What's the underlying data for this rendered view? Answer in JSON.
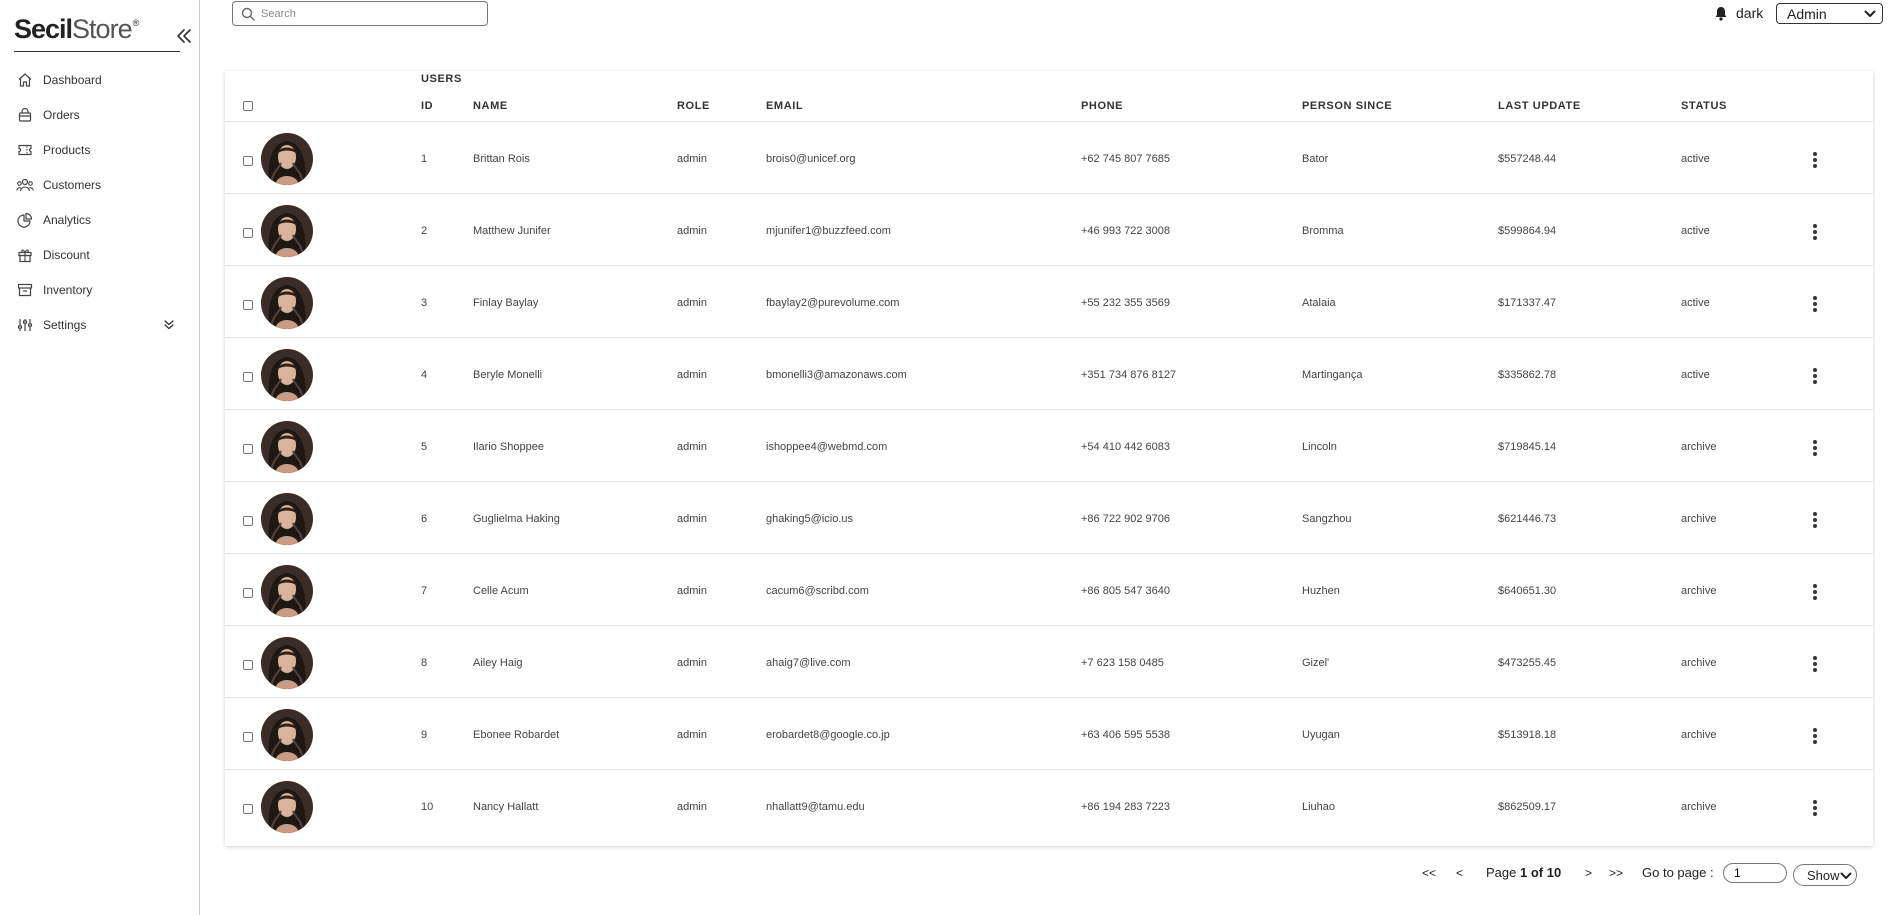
{
  "brand": {
    "name_bold": "Secil",
    "name_light": "Store",
    "mark": "®"
  },
  "sidebar": {
    "items": [
      {
        "label": "Dashboard",
        "icon": "home-icon"
      },
      {
        "label": "Orders",
        "icon": "shopping-bag-icon"
      },
      {
        "label": "Products",
        "icon": "ticket-icon"
      },
      {
        "label": "Customers",
        "icon": "users-icon"
      },
      {
        "label": "Analytics",
        "icon": "pie-chart-icon"
      },
      {
        "label": "Discount",
        "icon": "gift-icon"
      },
      {
        "label": "Inventory",
        "icon": "archive-icon"
      },
      {
        "label": "Settings",
        "icon": "sliders-icon"
      }
    ]
  },
  "search": {
    "placeholder": "Search"
  },
  "header": {
    "theme_label": "dark",
    "role_selected": "Admin"
  },
  "table": {
    "title": "USERS",
    "columns": {
      "id": "ID",
      "name": "NAME",
      "role": "ROLE",
      "email": "EMAIL",
      "phone": "PHONE",
      "person_since": "PERSON SINCE",
      "last_update": "LAST UPDATE",
      "status": "STATUS"
    },
    "rows": [
      {
        "id": "1",
        "name": "Brittan Rois",
        "role": "admin",
        "email": "brois0@unicef.org",
        "phone": "+62 745 807 7685",
        "person_since": "Bator",
        "last_update": "$557248.44",
        "status": "active"
      },
      {
        "id": "2",
        "name": "Matthew Junifer",
        "role": "admin",
        "email": "mjunifer1@buzzfeed.com",
        "phone": "+46 993 722 3008",
        "person_since": "Bromma",
        "last_update": "$599864.94",
        "status": "active"
      },
      {
        "id": "3",
        "name": "Finlay Baylay",
        "role": "admin",
        "email": "fbaylay2@purevolume.com",
        "phone": "+55 232 355 3569",
        "person_since": "Atalaia",
        "last_update": "$171337.47",
        "status": "active"
      },
      {
        "id": "4",
        "name": "Beryle Monelli",
        "role": "admin",
        "email": "bmonelli3@amazonaws.com",
        "phone": "+351 734 876 8127",
        "person_since": "Martingança",
        "last_update": "$335862.78",
        "status": "active"
      },
      {
        "id": "5",
        "name": "Ilario Shoppee",
        "role": "admin",
        "email": "ishoppee4@webmd.com",
        "phone": "+54 410 442 6083",
        "person_since": "Lincoln",
        "last_update": "$719845.14",
        "status": "archive"
      },
      {
        "id": "6",
        "name": "Guglielma Haking",
        "role": "admin",
        "email": "ghaking5@icio.us",
        "phone": "+86 722 902 9706",
        "person_since": "Sangzhou",
        "last_update": "$621446.73",
        "status": "archive"
      },
      {
        "id": "7",
        "name": "Celle Acum",
        "role": "admin",
        "email": "cacum6@scribd.com",
        "phone": "+86 805 547 3640",
        "person_since": "Huzhen",
        "last_update": "$640651.30",
        "status": "archive"
      },
      {
        "id": "8",
        "name": "Ailey Haig",
        "role": "admin",
        "email": "ahaig7@live.com",
        "phone": "+7 623 158 0485",
        "person_since": "Gizel'",
        "last_update": "$473255.45",
        "status": "archive"
      },
      {
        "id": "9",
        "name": "Ebonee Robardet",
        "role": "admin",
        "email": "erobardet8@google.co.jp",
        "phone": "+63 406 595 5538",
        "person_since": "Uyugan",
        "last_update": "$513918.18",
        "status": "archive"
      },
      {
        "id": "10",
        "name": "Nancy Hallatt",
        "role": "admin",
        "email": "nhallatt9@tamu.edu",
        "phone": "+86 194 283 7223",
        "person_since": "Liuhao",
        "last_update": "$862509.17",
        "status": "archive"
      }
    ]
  },
  "pagination": {
    "first": "<<",
    "prev": "<",
    "next": ">",
    "last": ">>",
    "page_prefix": "Page",
    "page_current": "1 of 10",
    "goto_label": "Go to page :",
    "goto_value": "1",
    "show_label": "Show"
  }
}
